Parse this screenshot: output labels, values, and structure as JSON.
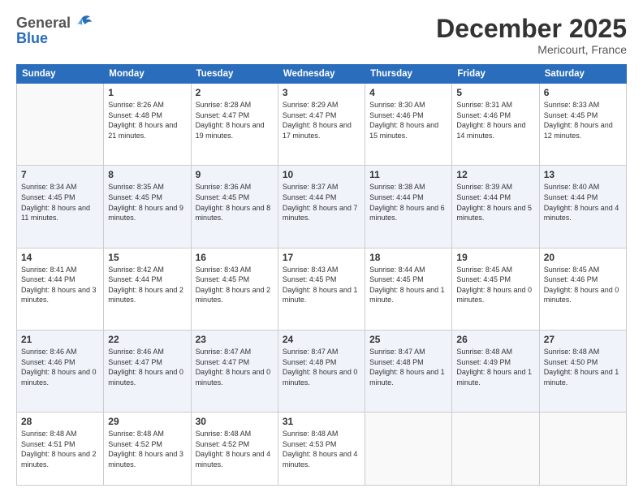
{
  "logo": {
    "general": "General",
    "blue": "Blue"
  },
  "header": {
    "month": "December 2025",
    "location": "Mericourt, France"
  },
  "weekdays": [
    "Sunday",
    "Monday",
    "Tuesday",
    "Wednesday",
    "Thursday",
    "Friday",
    "Saturday"
  ],
  "weeks": [
    [
      {
        "day": "",
        "sunrise": "",
        "sunset": "",
        "daylight": ""
      },
      {
        "day": "1",
        "sunrise": "Sunrise: 8:26 AM",
        "sunset": "Sunset: 4:48 PM",
        "daylight": "Daylight: 8 hours and 21 minutes."
      },
      {
        "day": "2",
        "sunrise": "Sunrise: 8:28 AM",
        "sunset": "Sunset: 4:47 PM",
        "daylight": "Daylight: 8 hours and 19 minutes."
      },
      {
        "day": "3",
        "sunrise": "Sunrise: 8:29 AM",
        "sunset": "Sunset: 4:47 PM",
        "daylight": "Daylight: 8 hours and 17 minutes."
      },
      {
        "day": "4",
        "sunrise": "Sunrise: 8:30 AM",
        "sunset": "Sunset: 4:46 PM",
        "daylight": "Daylight: 8 hours and 15 minutes."
      },
      {
        "day": "5",
        "sunrise": "Sunrise: 8:31 AM",
        "sunset": "Sunset: 4:46 PM",
        "daylight": "Daylight: 8 hours and 14 minutes."
      },
      {
        "day": "6",
        "sunrise": "Sunrise: 8:33 AM",
        "sunset": "Sunset: 4:45 PM",
        "daylight": "Daylight: 8 hours and 12 minutes."
      }
    ],
    [
      {
        "day": "7",
        "sunrise": "Sunrise: 8:34 AM",
        "sunset": "Sunset: 4:45 PM",
        "daylight": "Daylight: 8 hours and 11 minutes."
      },
      {
        "day": "8",
        "sunrise": "Sunrise: 8:35 AM",
        "sunset": "Sunset: 4:45 PM",
        "daylight": "Daylight: 8 hours and 9 minutes."
      },
      {
        "day": "9",
        "sunrise": "Sunrise: 8:36 AM",
        "sunset": "Sunset: 4:45 PM",
        "daylight": "Daylight: 8 hours and 8 minutes."
      },
      {
        "day": "10",
        "sunrise": "Sunrise: 8:37 AM",
        "sunset": "Sunset: 4:44 PM",
        "daylight": "Daylight: 8 hours and 7 minutes."
      },
      {
        "day": "11",
        "sunrise": "Sunrise: 8:38 AM",
        "sunset": "Sunset: 4:44 PM",
        "daylight": "Daylight: 8 hours and 6 minutes."
      },
      {
        "day": "12",
        "sunrise": "Sunrise: 8:39 AM",
        "sunset": "Sunset: 4:44 PM",
        "daylight": "Daylight: 8 hours and 5 minutes."
      },
      {
        "day": "13",
        "sunrise": "Sunrise: 8:40 AM",
        "sunset": "Sunset: 4:44 PM",
        "daylight": "Daylight: 8 hours and 4 minutes."
      }
    ],
    [
      {
        "day": "14",
        "sunrise": "Sunrise: 8:41 AM",
        "sunset": "Sunset: 4:44 PM",
        "daylight": "Daylight: 8 hours and 3 minutes."
      },
      {
        "day": "15",
        "sunrise": "Sunrise: 8:42 AM",
        "sunset": "Sunset: 4:44 PM",
        "daylight": "Daylight: 8 hours and 2 minutes."
      },
      {
        "day": "16",
        "sunrise": "Sunrise: 8:43 AM",
        "sunset": "Sunset: 4:45 PM",
        "daylight": "Daylight: 8 hours and 2 minutes."
      },
      {
        "day": "17",
        "sunrise": "Sunrise: 8:43 AM",
        "sunset": "Sunset: 4:45 PM",
        "daylight": "Daylight: 8 hours and 1 minute."
      },
      {
        "day": "18",
        "sunrise": "Sunrise: 8:44 AM",
        "sunset": "Sunset: 4:45 PM",
        "daylight": "Daylight: 8 hours and 1 minute."
      },
      {
        "day": "19",
        "sunrise": "Sunrise: 8:45 AM",
        "sunset": "Sunset: 4:45 PM",
        "daylight": "Daylight: 8 hours and 0 minutes."
      },
      {
        "day": "20",
        "sunrise": "Sunrise: 8:45 AM",
        "sunset": "Sunset: 4:46 PM",
        "daylight": "Daylight: 8 hours and 0 minutes."
      }
    ],
    [
      {
        "day": "21",
        "sunrise": "Sunrise: 8:46 AM",
        "sunset": "Sunset: 4:46 PM",
        "daylight": "Daylight: 8 hours and 0 minutes."
      },
      {
        "day": "22",
        "sunrise": "Sunrise: 8:46 AM",
        "sunset": "Sunset: 4:47 PM",
        "daylight": "Daylight: 8 hours and 0 minutes."
      },
      {
        "day": "23",
        "sunrise": "Sunrise: 8:47 AM",
        "sunset": "Sunset: 4:47 PM",
        "daylight": "Daylight: 8 hours and 0 minutes."
      },
      {
        "day": "24",
        "sunrise": "Sunrise: 8:47 AM",
        "sunset": "Sunset: 4:48 PM",
        "daylight": "Daylight: 8 hours and 0 minutes."
      },
      {
        "day": "25",
        "sunrise": "Sunrise: 8:47 AM",
        "sunset": "Sunset: 4:48 PM",
        "daylight": "Daylight: 8 hours and 1 minute."
      },
      {
        "day": "26",
        "sunrise": "Sunrise: 8:48 AM",
        "sunset": "Sunset: 4:49 PM",
        "daylight": "Daylight: 8 hours and 1 minute."
      },
      {
        "day": "27",
        "sunrise": "Sunrise: 8:48 AM",
        "sunset": "Sunset: 4:50 PM",
        "daylight": "Daylight: 8 hours and 1 minute."
      }
    ],
    [
      {
        "day": "28",
        "sunrise": "Sunrise: 8:48 AM",
        "sunset": "Sunset: 4:51 PM",
        "daylight": "Daylight: 8 hours and 2 minutes."
      },
      {
        "day": "29",
        "sunrise": "Sunrise: 8:48 AM",
        "sunset": "Sunset: 4:52 PM",
        "daylight": "Daylight: 8 hours and 3 minutes."
      },
      {
        "day": "30",
        "sunrise": "Sunrise: 8:48 AM",
        "sunset": "Sunset: 4:52 PM",
        "daylight": "Daylight: 8 hours and 4 minutes."
      },
      {
        "day": "31",
        "sunrise": "Sunrise: 8:48 AM",
        "sunset": "Sunset: 4:53 PM",
        "daylight": "Daylight: 8 hours and 4 minutes."
      },
      {
        "day": "",
        "sunrise": "",
        "sunset": "",
        "daylight": ""
      },
      {
        "day": "",
        "sunrise": "",
        "sunset": "",
        "daylight": ""
      },
      {
        "day": "",
        "sunrise": "",
        "sunset": "",
        "daylight": ""
      }
    ]
  ]
}
